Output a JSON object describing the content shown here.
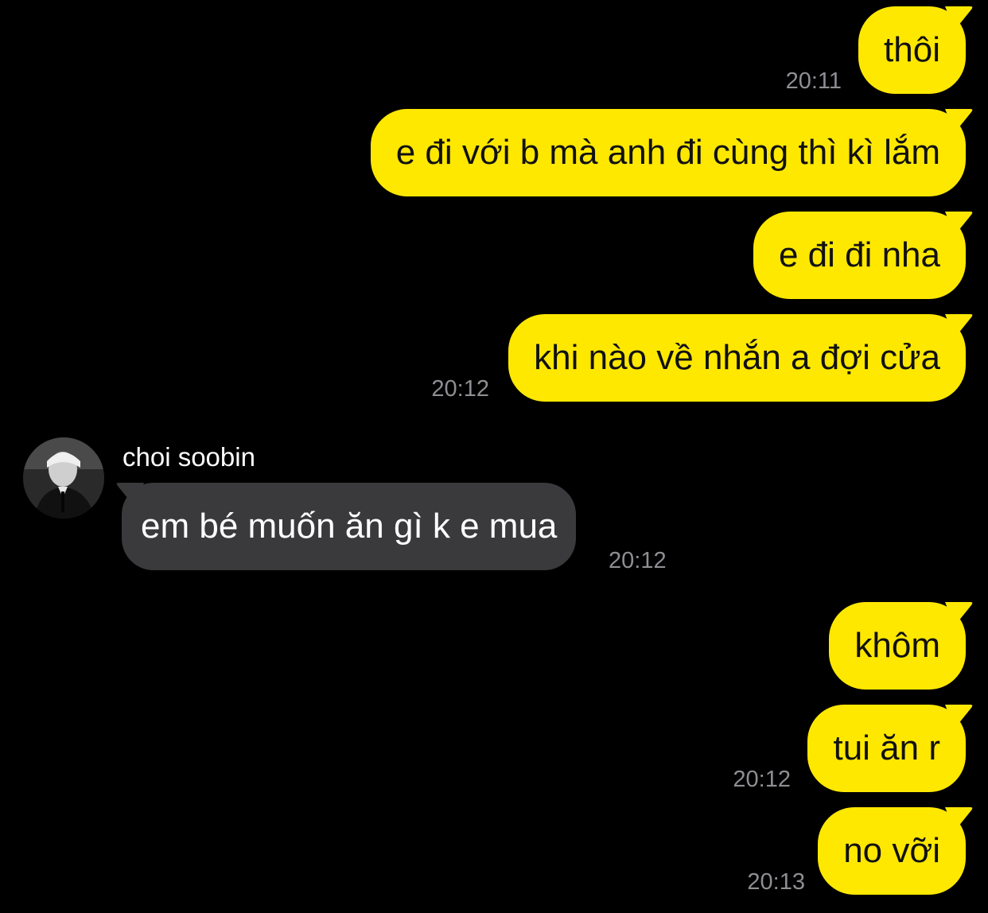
{
  "colors": {
    "background": "#000000",
    "outgoing_bubble": "#FFE800",
    "outgoing_text": "#111111",
    "incoming_bubble": "#3A3A3C",
    "incoming_text": "#FFFFFF",
    "timestamp": "#8E8E93"
  },
  "messages": [
    {
      "direction": "outgoing",
      "text": "thôi",
      "time": "20:11"
    },
    {
      "direction": "outgoing",
      "text": "e đi với b mà anh đi cùng thì kì lắm",
      "time": ""
    },
    {
      "direction": "outgoing",
      "text": "e đi đi nha",
      "time": ""
    },
    {
      "direction": "outgoing",
      "text": "khi nào về nhắn a đợi cửa",
      "time": "20:12"
    },
    {
      "direction": "incoming",
      "sender": "choi soobin",
      "avatar": "profile-photo",
      "text": "em bé muốn ăn gì k e mua",
      "time": "20:12"
    },
    {
      "direction": "outgoing",
      "text": "khôm",
      "time": ""
    },
    {
      "direction": "outgoing",
      "text": "tui ăn r",
      "time": "20:12"
    },
    {
      "direction": "outgoing",
      "text": "no vỡi",
      "time": "20:13"
    }
  ]
}
